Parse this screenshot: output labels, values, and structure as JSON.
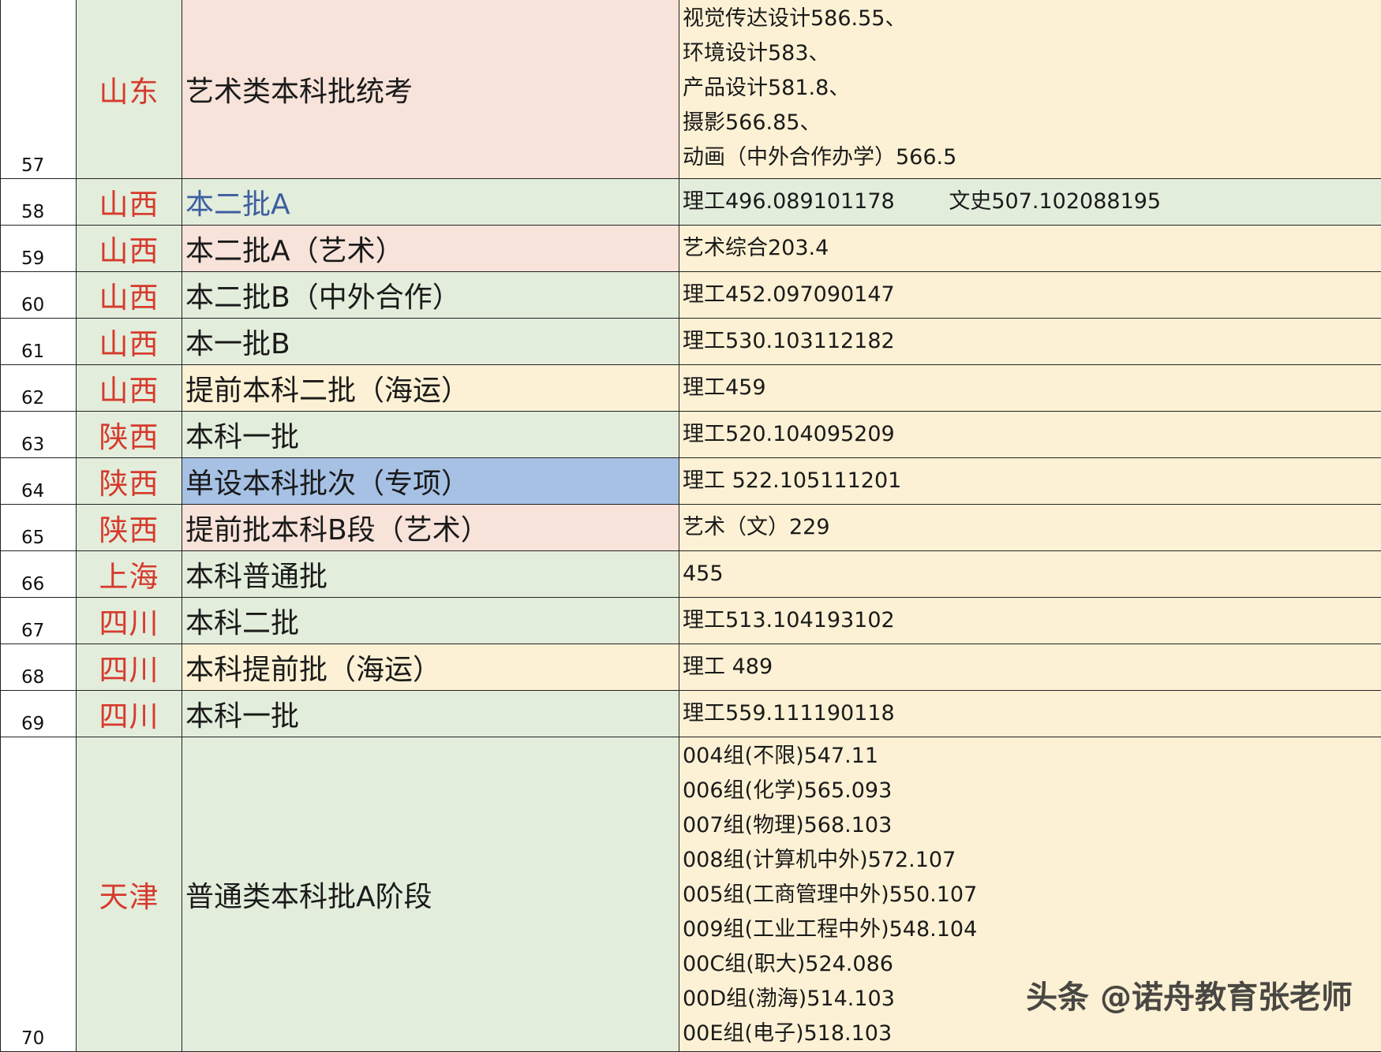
{
  "rows": [
    {
      "num": "57",
      "province": "山东",
      "batch": "艺术类本科批统考",
      "scores": [
        "视觉传达设计586.55、",
        "环境设计583、",
        "产品设计581.8、",
        "摄影566.85、",
        "动画（中外合作办学）566.5"
      ],
      "prov_bg": "#e3eddc",
      "batch_bg": "#f7e3da",
      "batch_color": "#1a1a1a",
      "score_bg": "#fcf1d4"
    },
    {
      "num": "58",
      "province": "山西",
      "batch": "本二批A",
      "scores": [
        "理工496.089101178        文史507.102088195"
      ],
      "prov_bg": "#e3eddc",
      "batch_bg": "#e3eddc",
      "batch_color": "#3d5fa0",
      "score_bg": "#e3eddc"
    },
    {
      "num": "59",
      "province": "山西",
      "batch": "本二批A（艺术）",
      "scores": [
        "艺术综合203.4"
      ],
      "prov_bg": "#e3eddc",
      "batch_bg": "#f7e3da",
      "batch_color": "#1a1a1a",
      "score_bg": "#fcf1d4"
    },
    {
      "num": "60",
      "province": "山西",
      "batch": "本二批B（中外合作）",
      "scores": [
        "理工452.097090147"
      ],
      "prov_bg": "#e3eddc",
      "batch_bg": "#e3eddc",
      "batch_color": "#1a1a1a",
      "score_bg": "#fcf1d4"
    },
    {
      "num": "61",
      "province": "山西",
      "batch": "本一批B",
      "scores": [
        "理工530.103112182"
      ],
      "prov_bg": "#e3eddc",
      "batch_bg": "#e3eddc",
      "batch_color": "#1a1a1a",
      "score_bg": "#fcf1d4"
    },
    {
      "num": "62",
      "province": "山西",
      "batch": "提前本科二批（海运）",
      "scores": [
        "理工459"
      ],
      "prov_bg": "#e3eddc",
      "batch_bg": "#fcf1d4",
      "batch_color": "#1a1a1a",
      "score_bg": "#fcf1d4"
    },
    {
      "num": "63",
      "province": "陕西",
      "batch": "本科一批",
      "scores": [
        "理工520.104095209"
      ],
      "prov_bg": "#e3eddc",
      "batch_bg": "#e3eddc",
      "batch_color": "#1a1a1a",
      "score_bg": "#fcf1d4"
    },
    {
      "num": "64",
      "province": "陕西",
      "batch": "单设本科批次（专项）",
      "scores": [
        "理工 522.105111201"
      ],
      "prov_bg": "#e3eddc",
      "batch_bg": "#a6c1e4",
      "batch_color": "#1a1a1a",
      "score_bg": "#fcf1d4"
    },
    {
      "num": "65",
      "province": "陕西",
      "batch": "提前批本科B段（艺术）",
      "scores": [
        "艺术（文）229"
      ],
      "prov_bg": "#e3eddc",
      "batch_bg": "#f7e3da",
      "batch_color": "#1a1a1a",
      "score_bg": "#fcf1d4"
    },
    {
      "num": "66",
      "province": "上海",
      "batch": "本科普通批",
      "scores": [
        "455"
      ],
      "prov_bg": "#e3eddc",
      "batch_bg": "#e3eddc",
      "batch_color": "#1a1a1a",
      "score_bg": "#fcf1d4"
    },
    {
      "num": "67",
      "province": "四川",
      "batch": "本科二批",
      "scores": [
        "理工513.104193102"
      ],
      "prov_bg": "#e3eddc",
      "batch_bg": "#e3eddc",
      "batch_color": "#1a1a1a",
      "score_bg": "#fcf1d4"
    },
    {
      "num": "68",
      "province": "四川",
      "batch": "本科提前批（海运）",
      "scores": [
        "理工 489"
      ],
      "prov_bg": "#e3eddc",
      "batch_bg": "#fcf1d4",
      "batch_color": "#1a1a1a",
      "score_bg": "#fcf1d4"
    },
    {
      "num": "69",
      "province": "四川",
      "batch": "本科一批",
      "scores": [
        "理工559.111190118"
      ],
      "prov_bg": "#e3eddc",
      "batch_bg": "#e3eddc",
      "batch_color": "#1a1a1a",
      "score_bg": "#fcf1d4"
    },
    {
      "num": "70",
      "province": "天津",
      "batch": "普通类本科批A阶段",
      "scores": [
        "004组(不限)547.11",
        "006组(化学)565.093",
        "007组(物理)568.103",
        "008组(计算机中外)572.107",
        "005组(工商管理中外)550.107",
        "009组(工业工程中外)548.104",
        "00C组(职大)524.086",
        "00D组(渤海)514.103",
        "00E组(电子)518.103"
      ],
      "prov_bg": "#e3eddc",
      "batch_bg": "#e3eddc",
      "batch_color": "#1a1a1a",
      "score_bg": "#fcf1d4"
    }
  ],
  "watermark": "头条 @诺舟教育张老师",
  "colors": {
    "province_text": "#d63a2c",
    "grid": "#222222"
  }
}
